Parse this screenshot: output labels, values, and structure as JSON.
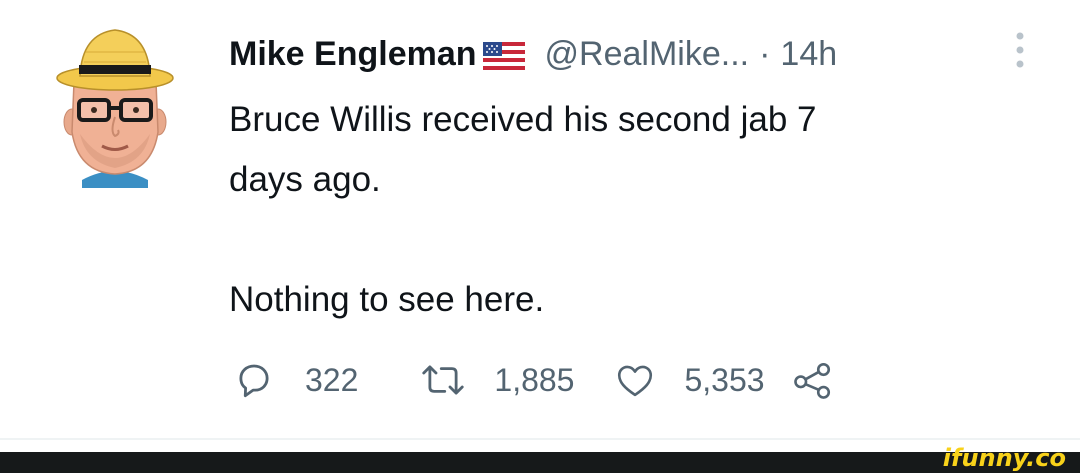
{
  "tweet": {
    "author_name": "Mike Engleman",
    "flag_icon": "us-flag-icon",
    "handle": "@RealMike...",
    "separator": "·",
    "time": "14h",
    "text_lines": [
      "Bruce Willis received his second jab 7",
      "days ago."
    ],
    "text_second_paragraph": "Nothing to see here."
  },
  "actions": {
    "reply_count": "322",
    "retweet_count": "1,885",
    "like_count": "5,353"
  },
  "watermark": {
    "text": "ifunny.co"
  },
  "colors": {
    "text_primary": "#0f1419",
    "text_secondary": "#536471",
    "footer_bg": "#16191a",
    "brand_yellow": "#f8d21a"
  }
}
